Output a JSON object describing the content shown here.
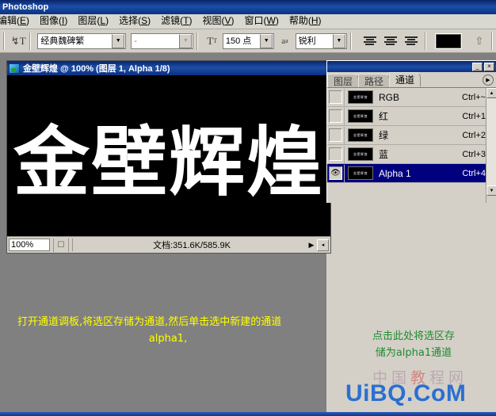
{
  "window": {
    "app_title": "Photoshop"
  },
  "menubar": {
    "items": [
      {
        "label": "编辑",
        "mnemonic": "E"
      },
      {
        "label": "图像",
        "mnemonic": "I"
      },
      {
        "label": "图层",
        "mnemonic": "L"
      },
      {
        "label": "选择",
        "mnemonic": "S"
      },
      {
        "label": "滤镜",
        "mnemonic": "T"
      },
      {
        "label": "视图",
        "mnemonic": "V"
      },
      {
        "label": "窗口",
        "mnemonic": "W"
      },
      {
        "label": "帮助",
        "mnemonic": "H"
      }
    ]
  },
  "options_bar": {
    "orientation_icon": "text-orientation-icon",
    "font_family": "经典魏碑繁",
    "font_style": "-",
    "size_icon": "font-size-icon",
    "font_size": "150 点",
    "antialias_icon": "anti-alias-icon",
    "antialias": "锐利",
    "align_left": "align-left-icon",
    "align_center": "align-center-icon",
    "align_right": "align-right-icon",
    "color_swatch": "#000000",
    "warp_icon": "warp-text-icon"
  },
  "document": {
    "title": "金壁辉煌 @ 100% (图层 1, Alpha 1/8)",
    "canvas_text": "金壁辉煌",
    "canvas_bg": "#000000",
    "canvas_fg": "#ffffff",
    "status": {
      "zoom": "100%",
      "doc_info": "文档:351.6K/585.9K"
    }
  },
  "panel": {
    "minimize_label": "_",
    "close_label": "×",
    "tabs": [
      {
        "label": "图层",
        "active": false
      },
      {
        "label": "路径",
        "active": false
      },
      {
        "label": "通道",
        "active": true
      }
    ],
    "menu_icon": "panel-menu-icon",
    "channels": [
      {
        "name": "RGB",
        "shortcut": "Ctrl+~",
        "visible": false,
        "selected": false,
        "thumb": "金壁辉煌"
      },
      {
        "name": "红",
        "shortcut": "Ctrl+1",
        "visible": false,
        "selected": false,
        "thumb": "金壁辉煌"
      },
      {
        "name": "绿",
        "shortcut": "Ctrl+2",
        "visible": false,
        "selected": false,
        "thumb": "金壁辉煌"
      },
      {
        "name": "蓝",
        "shortcut": "Ctrl+3",
        "visible": false,
        "selected": false,
        "thumb": "金壁辉煌"
      },
      {
        "name": "Alpha 1",
        "shortcut": "Ctrl+4",
        "visible": true,
        "selected": true,
        "thumb": "金壁辉煌"
      }
    ],
    "eye_glyph": "👁",
    "selected_color": "#00007f"
  },
  "annotations": {
    "yellow": {
      "line1": "打开通道调板,将选区存储为通道,然后单击选中新建的通道",
      "line2": "alpha1,",
      "color": "#ffff00"
    },
    "green": {
      "line1": "点击此处将选区存",
      "line2": "储为alpha1通道",
      "color": "#1f8b2f"
    }
  },
  "watermarks": {
    "cn_prefix": "中国",
    "cn_red": "教",
    "cn_suffix": "程网",
    "site": "UiBQ.CoM",
    "site_color": "#2b6fd0"
  }
}
